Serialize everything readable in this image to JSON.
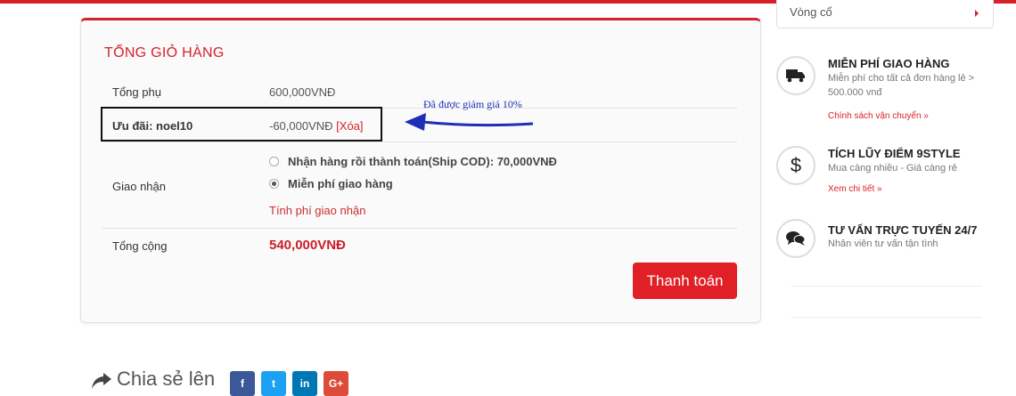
{
  "cart_totals": {
    "title": "TỔNG GIỎ HÀNG",
    "subtotal_label": "Tổng phụ",
    "subtotal_value": "600,000VNĐ",
    "coupon_label": "Ưu đãi: noel10",
    "coupon_value": "-60,000VNĐ",
    "coupon_remove": "[Xóa]",
    "shipping_label": "Giao nhận",
    "shipping_options": [
      {
        "label": "Nhận hàng rồi thành toán(Ship COD): 70,000VNĐ",
        "checked": false
      },
      {
        "label": "Miễn phí giao hàng",
        "checked": true
      }
    ],
    "calc_shipping_link": "Tính phí giao nhận",
    "total_label": "Tổng cộng",
    "total_value": "540,000VNĐ",
    "checkout_button": "Thanh toán"
  },
  "annotation": {
    "text": "Đã được giảm giá 10%",
    "color": "#1c2fb5"
  },
  "sidebar": {
    "select_value": "Vòng cổ",
    "features": [
      {
        "icon": "truck-icon",
        "title": "MIỄN PHÍ GIAO HÀNG",
        "desc": "Miễn phí cho tất cả đơn hàng lẻ > 500.000 vnđ",
        "link": "Chính sách vận chuyển »"
      },
      {
        "icon": "dollar-icon",
        "title": "TÍCH LŨY ĐIỂM 9STYLE",
        "desc": "Mua càng nhiều - Giá càng rẻ",
        "link": "Xem chi tiết »"
      },
      {
        "icon": "chat-icon",
        "title": "TƯ VẤN TRỰC TUYẾN 24/7",
        "desc": "Nhân viên tư vấn tận tình",
        "link": ""
      }
    ]
  },
  "share": {
    "label": "Chia sẻ lên",
    "networks": [
      {
        "name": "facebook-icon",
        "glyph": "f",
        "color": "#3b5998"
      },
      {
        "name": "twitter-icon",
        "glyph": "t",
        "color": "#1da1f2"
      },
      {
        "name": "linkedin-icon",
        "glyph": "in",
        "color": "#0077b5"
      },
      {
        "name": "google-plus-icon",
        "glyph": "G+",
        "color": "#dd4b39"
      }
    ]
  },
  "colors": {
    "brand_red": "#d7212b",
    "checkout_red": "#e01f26"
  }
}
